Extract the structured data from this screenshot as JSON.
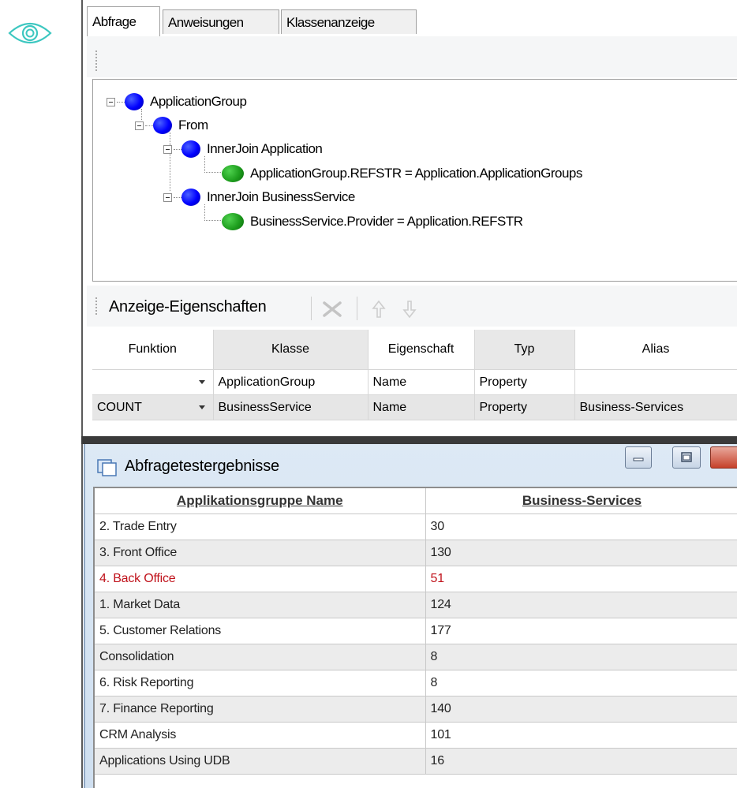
{
  "tabs": [
    {
      "label": "Abfrage"
    },
    {
      "label": "Anweisungen"
    },
    {
      "label": "Klassenanzeige"
    }
  ],
  "query_tree": {
    "root": "ApplicationGroup",
    "from": "From",
    "join1": "InnerJoin  Application",
    "cond1": "ApplicationGroup.REFSTR = Application.ApplicationGroups",
    "join2": "InnerJoin  BusinessService",
    "cond2": "BusinessService.Provider = Application.REFSTR"
  },
  "display_toolbar": {
    "title": "Anzeige-Eigenschaften",
    "icons": [
      "delete-icon",
      "arrow-up-icon",
      "arrow-down-icon"
    ]
  },
  "properties_grid": {
    "columns": [
      "Funktion",
      "Klasse",
      "Eigenschaft",
      "Typ",
      "Alias"
    ],
    "rows": [
      {
        "funktion": "",
        "klasse": "ApplicationGroup",
        "eigenschaft": "Name",
        "typ": "Property",
        "alias": ""
      },
      {
        "funktion": "COUNT",
        "klasse": "BusinessService",
        "eigenschaft": "Name",
        "typ": "Property",
        "alias": "Business-Services"
      }
    ]
  },
  "results_window": {
    "title": "Abfragetestergebnisse",
    "columns": [
      "Applikationsgruppe Name",
      "Business-Services"
    ],
    "rows": [
      {
        "name": "2. Trade Entry",
        "count": "30"
      },
      {
        "name": "3. Front Office",
        "count": "130"
      },
      {
        "name": "4. Back Office",
        "count": "51"
      },
      {
        "name": "1. Market Data",
        "count": "124"
      },
      {
        "name": "5. Customer Relations",
        "count": "177"
      },
      {
        "name": "Consolidation",
        "count": "8"
      },
      {
        "name": "6. Risk Reporting",
        "count": "8"
      },
      {
        "name": "7. Finance Reporting",
        "count": "140"
      },
      {
        "name": "CRM Analysis",
        "count": "101"
      },
      {
        "name": "Applications Using UDB",
        "count": "16"
      }
    ],
    "highlight_color": "#c0121b"
  },
  "colors": {
    "node_table": "#0000ff",
    "node_condition": "#1e9e1e",
    "eye_icon": "#3cc7c0"
  }
}
